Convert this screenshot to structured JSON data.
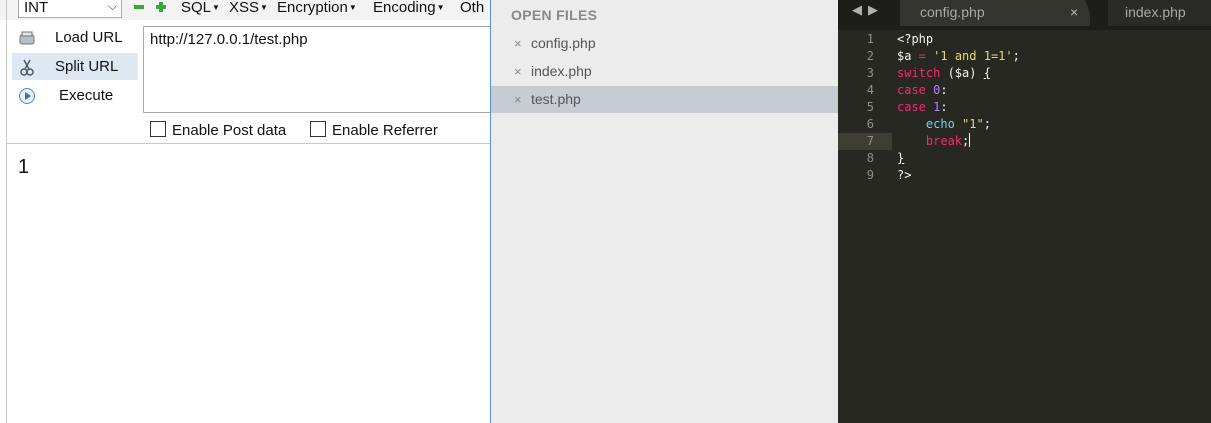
{
  "hackbar": {
    "select_value": "INT",
    "menus": [
      "SQL",
      "XSS",
      "Encryption",
      "Encoding",
      "Oth"
    ],
    "buttons": {
      "load": "Load URL",
      "split": "Split URL",
      "execute": "Execute"
    },
    "url_value": "http://127.0.0.1/test.php",
    "checkboxes": {
      "post": "Enable Post data",
      "referrer": "Enable Referrer"
    },
    "output": "1",
    "icons": {
      "minus": "minus-icon",
      "plus": "plus-icon",
      "load": "load-url-icon",
      "split": "scissors-icon",
      "execute": "play-icon"
    }
  },
  "sidebar": {
    "heading": "OPEN FILES",
    "files": [
      "config.php",
      "index.php",
      "test.php"
    ],
    "active_index": 2,
    "close_glyph": "×"
  },
  "editor": {
    "tabs": [
      "config.php",
      "index.php"
    ],
    "tab_close": "×",
    "line_numbers": [
      "1",
      "2",
      "3",
      "4",
      "5",
      "6",
      "7",
      "8",
      "9"
    ],
    "current_line": 7,
    "code": {
      "l1_open": "<?php",
      "l2_var": "$a",
      "l2_eq": " = ",
      "l2_str": "'1 and 1=1'",
      "l2_end": ";",
      "l3_kw": "switch",
      "l3_rest": " ($a) ",
      "l3_brace": "{",
      "l4_kw": "case",
      "l4_num": "0",
      "l4_colon": ":",
      "l5_kw": "case",
      "l5_num": "1",
      "l5_colon": ":",
      "l6_indent": "    ",
      "l6_fn": "echo",
      "l6_str": "\"1\"",
      "l6_end": ";",
      "l7_indent": "    ",
      "l7_kw": "break",
      "l7_end": ";",
      "l8_brace": "}",
      "l9_close": "?>"
    },
    "colors": {
      "background": "#272822",
      "keyword": "#f92672",
      "string": "#e6db74",
      "number": "#ae81ff",
      "function": "#66d9ef"
    }
  }
}
